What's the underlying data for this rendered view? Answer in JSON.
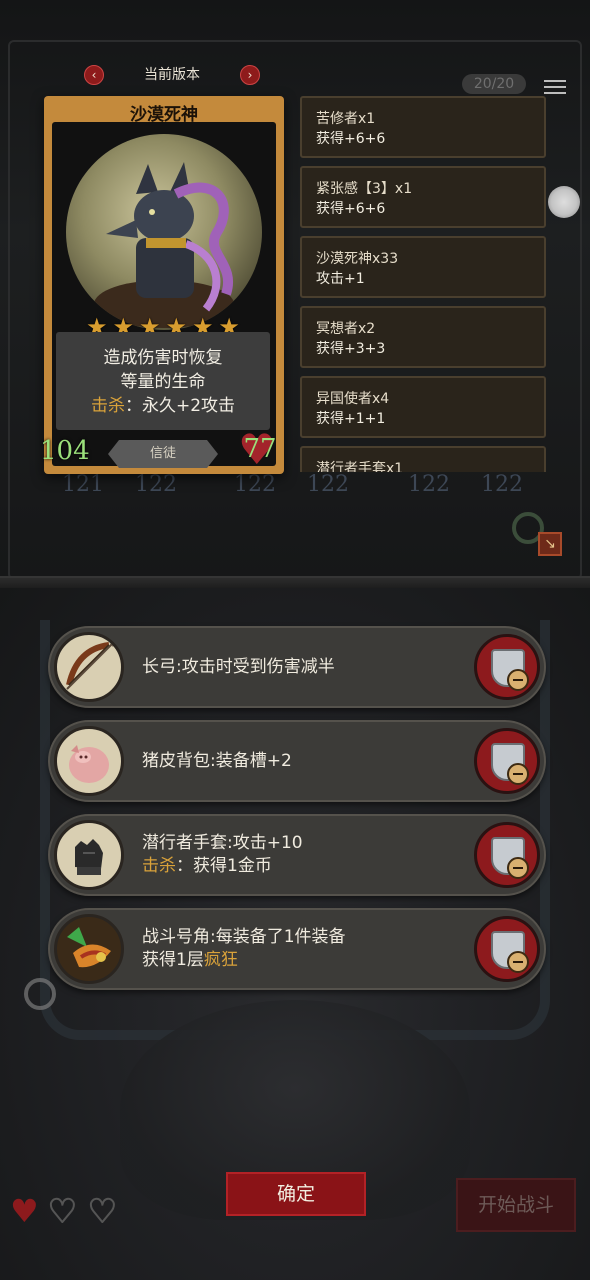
{
  "header": {
    "version_title": "当前版本",
    "prev_glyph": "‹",
    "next_glyph": "›",
    "counter": "20/20"
  },
  "hero": {
    "name": "沙漠死神",
    "stars": 6,
    "star_glyph": "★",
    "desc_line1": "造成伤害时恢复",
    "desc_line2": "等量的生命",
    "kill_label": "击杀",
    "kill_sep": "：",
    "kill_effect": "永久+2攻击",
    "attack": "104",
    "health": "77",
    "tribe": "信徒",
    "heart_glyph": "♥"
  },
  "background_stats": [
    {
      "atk": "121",
      "hp": "122"
    },
    {
      "atk": "122",
      "hp": "122"
    },
    {
      "atk": "122",
      "hp": "122"
    }
  ],
  "buffs": [
    {
      "name": "苦修者x1",
      "effect": "获得+6+6"
    },
    {
      "name": "紧张感【3】x1",
      "effect": "获得+6+6"
    },
    {
      "name": "沙漠死神x33",
      "effect": "攻击+1"
    },
    {
      "name": "冥想者x2",
      "effect": "获得+3+3"
    },
    {
      "name": "异国使者x4",
      "effect": "获得+1+1"
    },
    {
      "name": "潜行者手套x1",
      "effect": ""
    }
  ],
  "equipment": [
    {
      "icon": "longbow-icon",
      "line1": "长弓:攻击时受到伤害减半",
      "line2_label": "",
      "line2_text": ""
    },
    {
      "icon": "pigskin-backpack-icon",
      "line1": "猪皮背包:装备槽+2",
      "line2_label": "",
      "line2_text": ""
    },
    {
      "icon": "stalker-gloves-icon",
      "line1": "潜行者手套:攻击+10",
      "line2_label": "击杀",
      "line2_sep": "：",
      "line2_text": "获得1金币"
    },
    {
      "icon": "battle-horn-icon",
      "line1": "战斗号角:每装备了1件装备",
      "line2_prefix": "获得1层",
      "line2_highlight": "疯狂"
    }
  ],
  "lives": {
    "full": 1,
    "total": 3,
    "glyph": "♥"
  },
  "buttons": {
    "confirm": "确定",
    "start_battle": "开始战斗"
  },
  "colors": {
    "accent_red": "#8a1317",
    "gold": "#d89d2f",
    "kill_orange": "#d9a23a",
    "stat_green": "#9be07b"
  }
}
